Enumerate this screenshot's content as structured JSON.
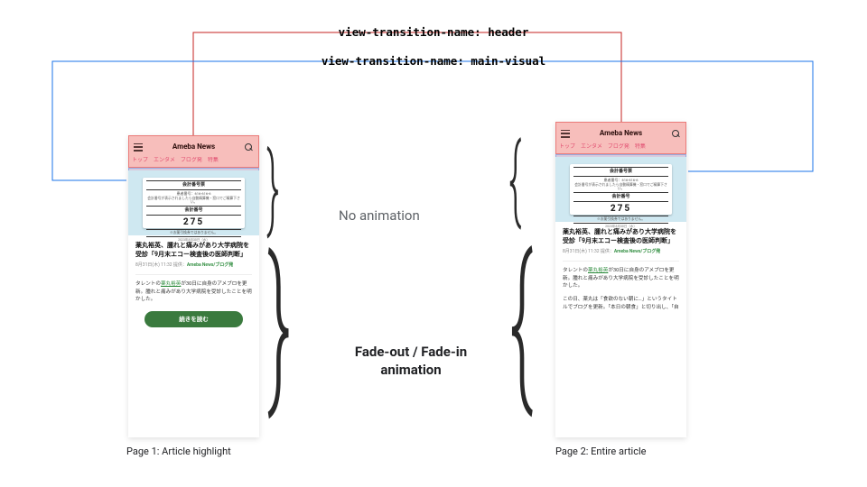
{
  "labels": {
    "header": "view-transition-name: header",
    "main_visual": "view-transition-name: main-visual",
    "no_anim": "No animation",
    "fade_anim": "Fade-out / Fade-in animation"
  },
  "captions": {
    "page1": "Page 1: Article highlight",
    "page2": "Page 2: Entire article"
  },
  "phone": {
    "brand": "Ameba News",
    "tabs": [
      "トップ",
      "エンタメ",
      "ブログ発",
      "特集"
    ],
    "ticket": {
      "line1": "会計番号票",
      "line2": "患者番号：616-616-6",
      "line3": "会計番号が表示されましたら自動精算機・窓口でご精算下さい。",
      "line4": "会計番号",
      "line5": "275",
      "line6": "※お薬引換券ではありません。",
      "line7": "2023年8月30日（水）"
    },
    "headline": "薬丸裕英、腫れと痛みがあり大学病院を受診「9月末エコー検査後の医師判断」",
    "meta_time": "8月31日(木) 11:32",
    "meta_provider": "提供：",
    "meta_source": "Ameba News/ブログ発",
    "body_p1_a": "タレントの",
    "body_p1_link": "薬丸裕英",
    "body_p1_b": "が30日に自身のアメブロを更新。腫れと痛みがあり大学病院を受診したことを明かした。",
    "body_p2": "この日、薬丸は「食欲のない朝に…」というタイトルでブログを更新。「本日の朝食」と切り出し、「自",
    "cta": "続きを読む"
  }
}
